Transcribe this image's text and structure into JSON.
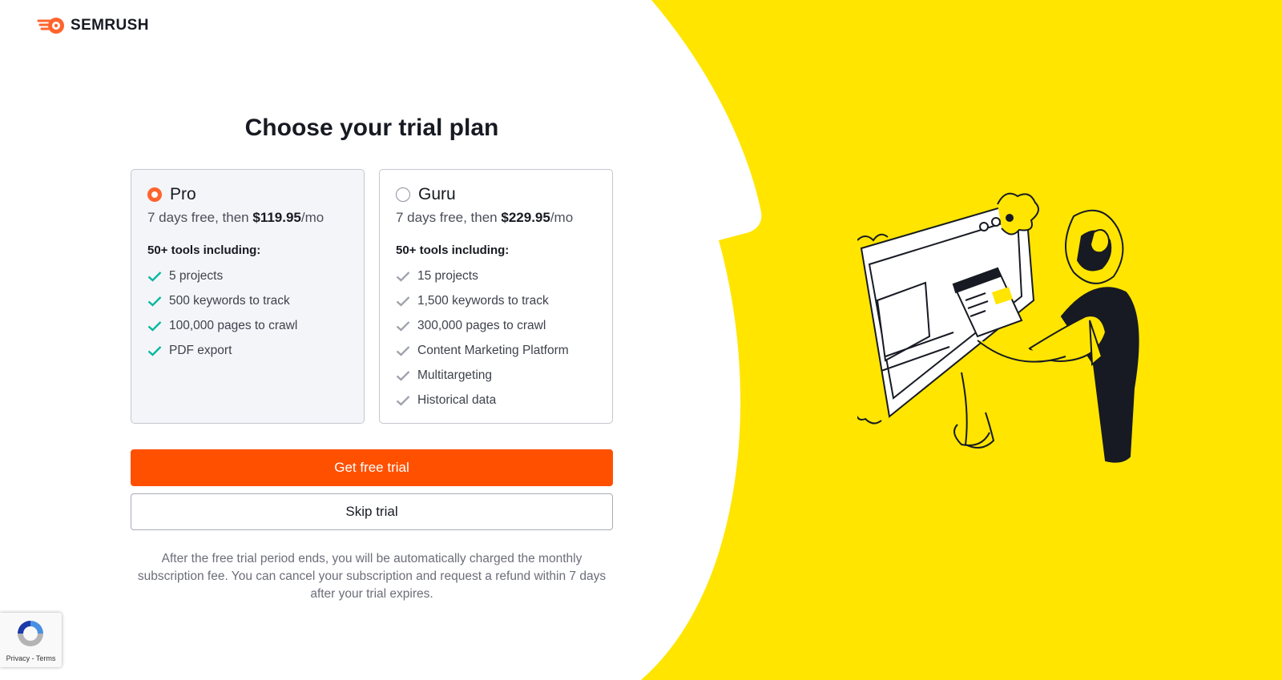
{
  "brand": {
    "name": "SEMRUSH",
    "accent_color": "#ff642d"
  },
  "page": {
    "title": "Choose your trial plan",
    "background_accent": "#ffe500"
  },
  "plans": [
    {
      "name": "Pro",
      "selected": true,
      "price_prefix": "7 days free, then ",
      "price_amount": "$119.95",
      "price_suffix": "/mo",
      "tools_heading": "50+ tools including:",
      "features": [
        "5 projects",
        "500 keywords to track",
        "100,000 pages to crawl",
        "PDF export"
      ]
    },
    {
      "name": "Guru",
      "selected": false,
      "price_prefix": "7 days free, then ",
      "price_amount": "$229.95",
      "price_suffix": "/mo",
      "tools_heading": "50+ tools including:",
      "features": [
        "15 projects",
        "1,500 keywords to track",
        "300,000 pages to crawl",
        "Content Marketing Platform",
        "Multitargeting",
        "Historical data"
      ]
    }
  ],
  "actions": {
    "primary_label": "Get free trial",
    "secondary_label": "Skip trial"
  },
  "disclaimer": "After the free trial period ends, you will be automatically charged the monthly subscription fee. You can cancel your subscription and request a refund within 7 days after your trial expires.",
  "recaptcha": {
    "links": "Privacy - Terms"
  },
  "icons": {
    "logo": "semrush-flame-icon",
    "check": "check-icon",
    "radio": "radio-icon",
    "recaptcha": "recaptcha-icon"
  },
  "colors": {
    "check_selected": "#00b8a0",
    "check_unselected": "#9ea2ac",
    "cta": "#ff5000"
  }
}
